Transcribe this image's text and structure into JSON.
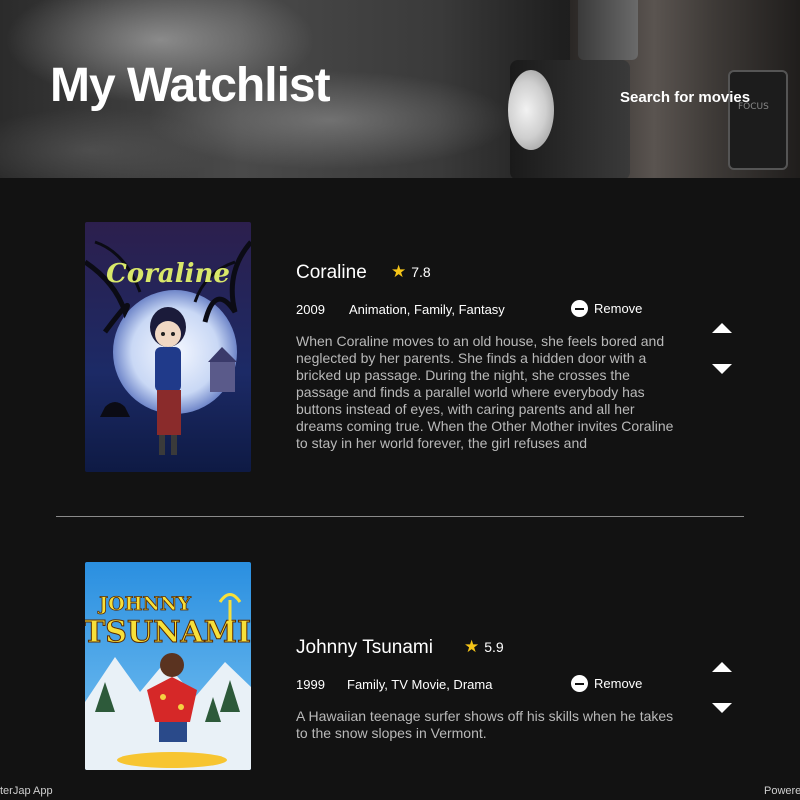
{
  "header": {
    "title": "My Watchlist",
    "search_link": "Search for movies",
    "projector_label": "FOCUS"
  },
  "movies": [
    {
      "title": "Coraline",
      "rating": "7.8",
      "year": "2009",
      "genres": "Animation, Family, Fantasy",
      "remove_label": "Remove",
      "overview": "When Coraline moves to an old house, she feels bored and neglected by her parents. She finds a hidden door with a bricked up passage. During the night, she crosses the passage and finds a parallel world where everybody has buttons instead of eyes, with caring parents and all her dreams coming true. When the Other Mother invites Coraline to stay in her world forever, the girl refuses and",
      "poster_text": "Coraline"
    },
    {
      "title": "Johnny Tsunami",
      "rating": "5.9",
      "year": "1999",
      "genres": "Family, TV Movie, Drama",
      "remove_label": "Remove",
      "overview": "A Hawaiian teenage surfer shows off his skills when he takes to the snow slopes in Vermont.",
      "poster_text_1": "JOHNNY",
      "poster_text_2": "TSUNAMI"
    }
  ],
  "footer": {
    "left": "terJap App",
    "right": "Powere"
  },
  "colors": {
    "background": "#121212",
    "star": "#f5c518",
    "overview_text": "#b9b9b9"
  }
}
